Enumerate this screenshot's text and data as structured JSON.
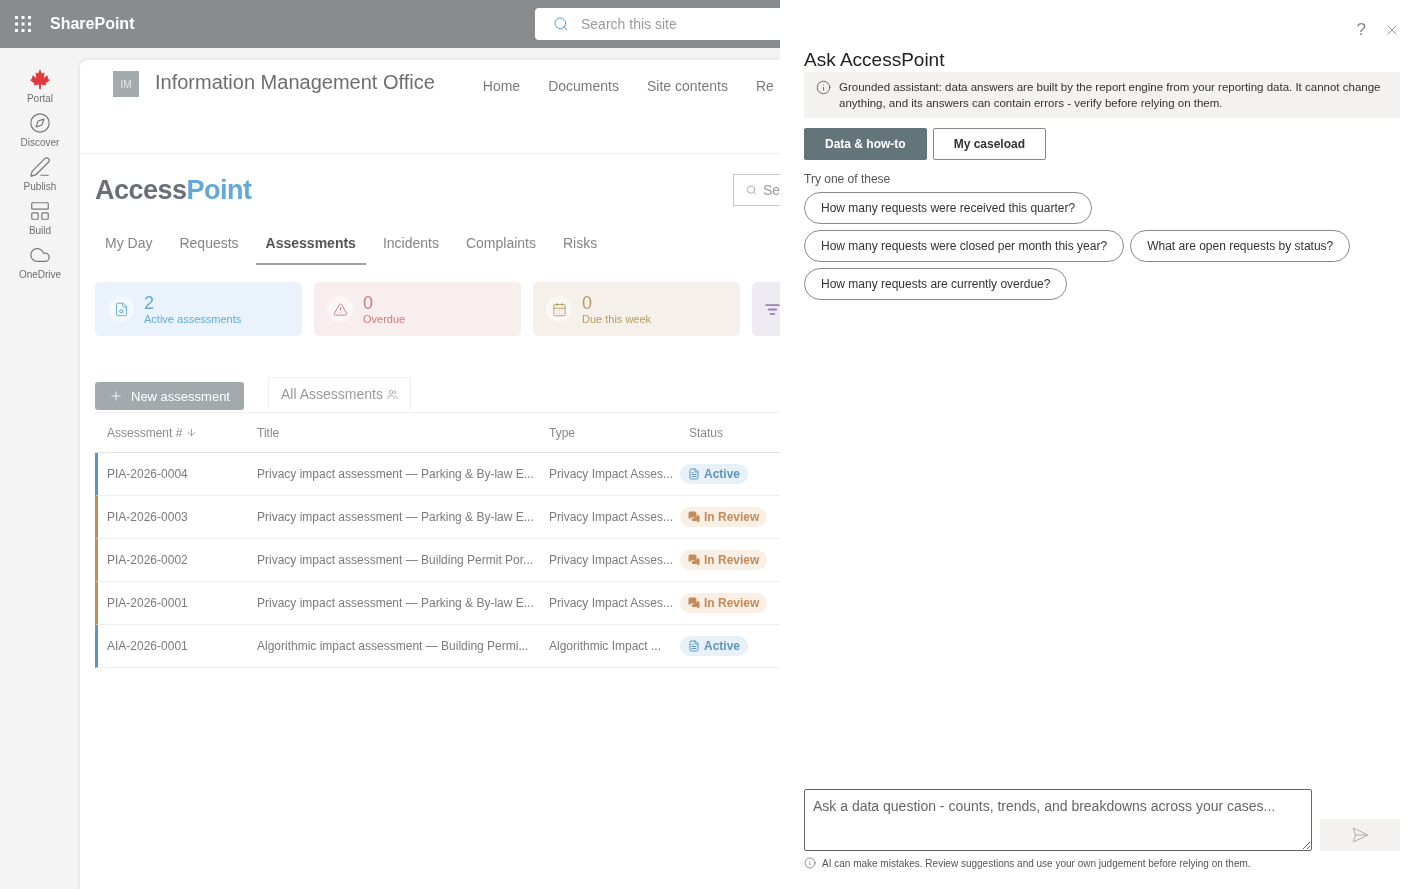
{
  "app_bar": {
    "title": "SharePoint",
    "search_placeholder": "Search this site"
  },
  "rail": [
    {
      "label": "Portal",
      "kind": "leaf"
    },
    {
      "label": "Discover",
      "kind": "compass"
    },
    {
      "label": "Publish",
      "kind": "pen"
    },
    {
      "label": "Build",
      "kind": "layout"
    },
    {
      "label": "OneDrive",
      "kind": "cloud"
    }
  ],
  "site": {
    "logo": "IM",
    "title": "Information Management Office",
    "nav": [
      "Home",
      "Documents",
      "Site contents",
      "Re"
    ]
  },
  "app": {
    "logo_first": "Access",
    "logo_second": "Point",
    "search_placeholder": "Se"
  },
  "tabs": [
    {
      "label": "My Day",
      "selected": false
    },
    {
      "label": "Requests",
      "selected": false
    },
    {
      "label": "Assessments",
      "selected": true
    },
    {
      "label": "Incidents",
      "selected": false
    },
    {
      "label": "Complaints",
      "selected": false
    },
    {
      "label": "Risks",
      "selected": false
    }
  ],
  "stats": [
    {
      "value": "2",
      "label": "Active assessments",
      "kind": "active"
    },
    {
      "value": "0",
      "label": "Overdue",
      "kind": "overdue"
    },
    {
      "value": "0",
      "label": "Due this week",
      "kind": "due"
    },
    {
      "kind": "partial"
    }
  ],
  "toolbar": {
    "new_button": "New assessment",
    "view": "All Assessments"
  },
  "table": {
    "columns": [
      {
        "label": "Assessment #",
        "sorted": true
      },
      {
        "label": "Title",
        "sorted": false
      },
      {
        "label": "Type",
        "sorted": false
      },
      {
        "label": "Status",
        "sorted": false
      }
    ],
    "rows": [
      {
        "id": "PIA-2026-0004",
        "title": "Privacy impact assessment — Parking & By-law E...",
        "type": "Privacy Impact Asses...",
        "status": {
          "label": "Active",
          "kind": "active"
        }
      },
      {
        "id": "PIA-2026-0003",
        "title": "Privacy impact assessment — Parking & By-law E...",
        "type": "Privacy Impact Asses...",
        "status": {
          "label": "In Review",
          "kind": "review"
        }
      },
      {
        "id": "PIA-2026-0002",
        "title": "Privacy impact assessment — Building Permit Por...",
        "type": "Privacy Impact Asses...",
        "status": {
          "label": "In Review",
          "kind": "review"
        }
      },
      {
        "id": "PIA-2026-0001",
        "title": "Privacy impact assessment — Parking & By-law E...",
        "type": "Privacy Impact Asses...",
        "status": {
          "label": "In Review",
          "kind": "review"
        }
      },
      {
        "id": "AIA-2026-0001",
        "title": "Algorithmic impact assessment — Building Permi...",
        "type": "Algorithmic Impact ...",
        "status": {
          "label": "Active",
          "kind": "active"
        }
      }
    ]
  },
  "panel": {
    "help": "?",
    "title": "Ask AccessPoint",
    "notice": "Grounded assistant: data answers are built by the report engine from your reporting data. It cannot change anything, and its answers can contain errors - verify before relying on them.",
    "modes": [
      {
        "label": "Data & how-to",
        "selected": true
      },
      {
        "label": "My caseload",
        "selected": false
      }
    ],
    "suggestions_heading": "Try one of these",
    "suggestions": [
      [
        "How many requests were received this quarter?"
      ],
      [
        "How many requests were closed per month this year?",
        "What are open requests by status?"
      ],
      [
        "How many requests are currently overdue?"
      ]
    ],
    "input_placeholder": "Ask a data question - counts, trends, and breakdowns across your cases...",
    "disclaimer": "AI can make mistakes. Review suggestions and use your own judgement before relying on them."
  }
}
